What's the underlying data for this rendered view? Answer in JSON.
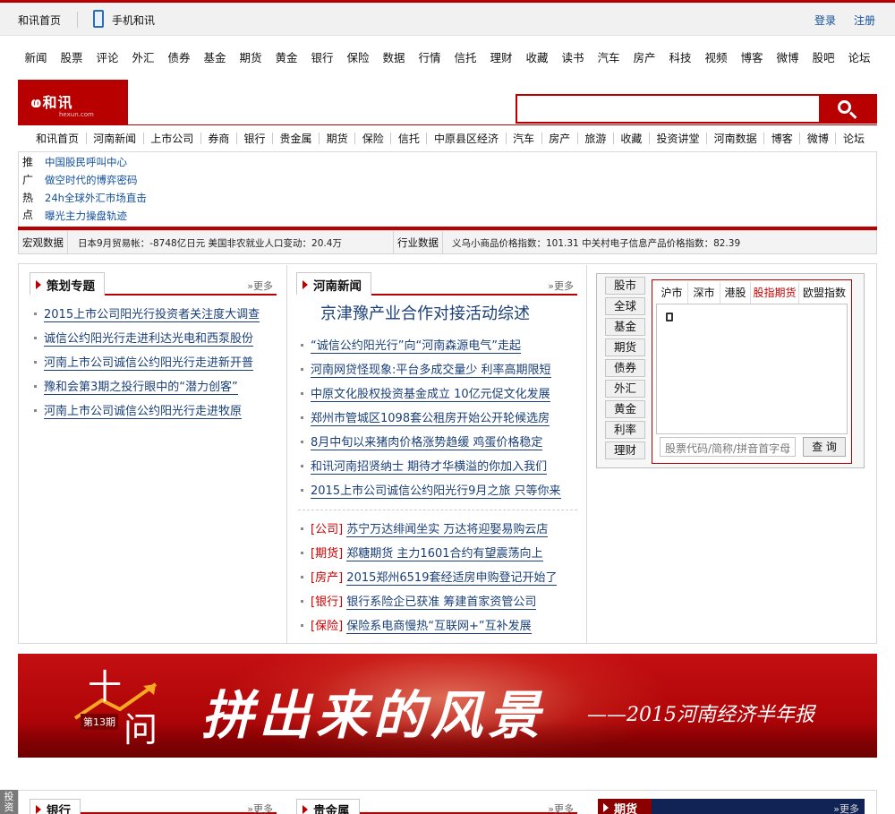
{
  "topbar": {
    "home": "和讯首页",
    "mobile": "手机和讯",
    "login": "登录",
    "register": "注册"
  },
  "main_nav": [
    "新闻",
    "股票",
    "评论",
    "外汇",
    "债券",
    "基金",
    "期货",
    "黄金",
    "银行",
    "保险",
    "数据",
    "行情",
    "信托",
    "理财",
    "收藏",
    "读书",
    "汽车",
    "房产",
    "科技",
    "视频",
    "博客",
    "微博",
    "股吧",
    "论坛"
  ],
  "logo": {
    "text": "和讯",
    "url": "hexun.com"
  },
  "search": {
    "placeholder": ""
  },
  "sub_nav": [
    "和讯首页",
    "河南新闻",
    "上市公司",
    "券商",
    "银行",
    "贵金属",
    "期货",
    "保险",
    "信托",
    "中原县区经济",
    "汽车",
    "房产",
    "旅游",
    "收藏",
    "投资讲堂",
    "河南数据",
    "博客",
    "微博",
    "论坛"
  ],
  "promo": {
    "tags": [
      "推",
      "广",
      "热",
      "点"
    ],
    "links": [
      "中国股民呼叫中心",
      "做空时代的博弈密码",
      "24h全球外汇市场直击",
      "曝光主力操盘轨迹"
    ]
  },
  "ticker": {
    "macro_label": "宏观数据",
    "macro_text": "日本9月贸易帐：-8748亿日元  美国非农就业人口变动：20.4万",
    "industry_label": "行业数据",
    "industry_text": "义乌小商品价格指数：101.31  中关村电子信息产品价格指数：82.39"
  },
  "col1": {
    "title": "策划专题",
    "more": "»更多",
    "items": [
      "2015上市公司阳光行投资者关注度大调查",
      "诚信公约阳光行走进利达光电和西泵股份",
      "河南上市公司诚信公约阳光行走进新开普",
      "豫和会第3期之投行眼中的“潜力创客”",
      "河南上市公司诚信公约阳光行走进牧原"
    ]
  },
  "col2": {
    "title": "河南新闻",
    "more": "»更多",
    "headline": "京津豫产业合作对接活动综述",
    "items": [
      "“诚信公约阳光行”向“河南森源电气”走起",
      "河南网贷怪现象:平台多成交量少 利率高期限短",
      "中原文化股权投资基金成立 10亿元促文化发展",
      "郑州市管城区1098套公租房开始公开轮候选房",
      "8月中旬以来猪肉价格涨势趋缓 鸡蛋价格稳定",
      "和讯河南招贤纳士 期待才华横溢的你加入我们",
      "2015上市公司诚信公约阳光行9月之旅 只等你来"
    ],
    "cat_items": [
      {
        "cat": "[公司]",
        "text": "苏宁万达绯闻坐实 万达将迎娶易购云店"
      },
      {
        "cat": "[期货]",
        "text": "郑糖期货 主力1601合约有望震荡向上"
      },
      {
        "cat": "[房产]",
        "text": "2015郑州6519套经适房申购登记开始了"
      },
      {
        "cat": "[银行]",
        "text": "银行系险企已获准 筹建首家资管公司"
      },
      {
        "cat": "[保险]",
        "text": "保险系电商慢热“互联网+”互补发展"
      }
    ]
  },
  "quote": {
    "side_buttons": [
      "股市",
      "全球",
      "基金",
      "期货",
      "债券",
      "外汇",
      "黄金",
      "利率",
      "理财"
    ],
    "tabs": [
      "沪市",
      "深市",
      "港股",
      "股指期货",
      "欧盟指数"
    ],
    "active_tab": "股指期货",
    "input_placeholder": "股票代码/简称/拼音首字母",
    "submit": "查 询"
  },
  "banner": {
    "ten": "十",
    "wen": "问",
    "issue": "第13期",
    "slogan": "拼出来的风景",
    "report": "——2015河南经济半年报"
  },
  "bottom": {
    "side_tab": "投资",
    "sections": [
      {
        "title": "银行",
        "more": "»更多"
      },
      {
        "title": "贵金属",
        "more": "»更多"
      },
      {
        "title": "期货",
        "more": "»更多"
      }
    ]
  },
  "colors": {
    "brand_red": "#b80000",
    "link_blue": "#1a3f78"
  }
}
